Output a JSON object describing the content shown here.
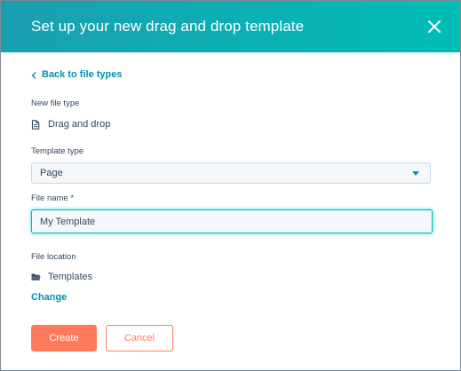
{
  "dialog": {
    "title": "Set up your new drag and drop template",
    "close_icon": "close-icon"
  },
  "back_link": {
    "label": "Back to file types",
    "icon": "chevron-left-icon"
  },
  "new_file_type": {
    "label": "New file type",
    "value": "Drag and drop",
    "icon": "file-icon"
  },
  "template_type": {
    "label": "Template type",
    "selected": "Page",
    "icon": "caret-down-icon"
  },
  "file_name": {
    "label": "File name *",
    "value": "My Template"
  },
  "file_location": {
    "label": "File location",
    "value": "Templates",
    "icon": "folder-icon",
    "change_label": "Change"
  },
  "actions": {
    "create_label": "Create",
    "cancel_label": "Cancel"
  },
  "colors": {
    "header_start": "#1a9fb0",
    "header_end": "#00bdb6",
    "link": "#0091ae",
    "primary": "#ff7a59",
    "text": "#33475b",
    "focus": "#00bda5"
  }
}
